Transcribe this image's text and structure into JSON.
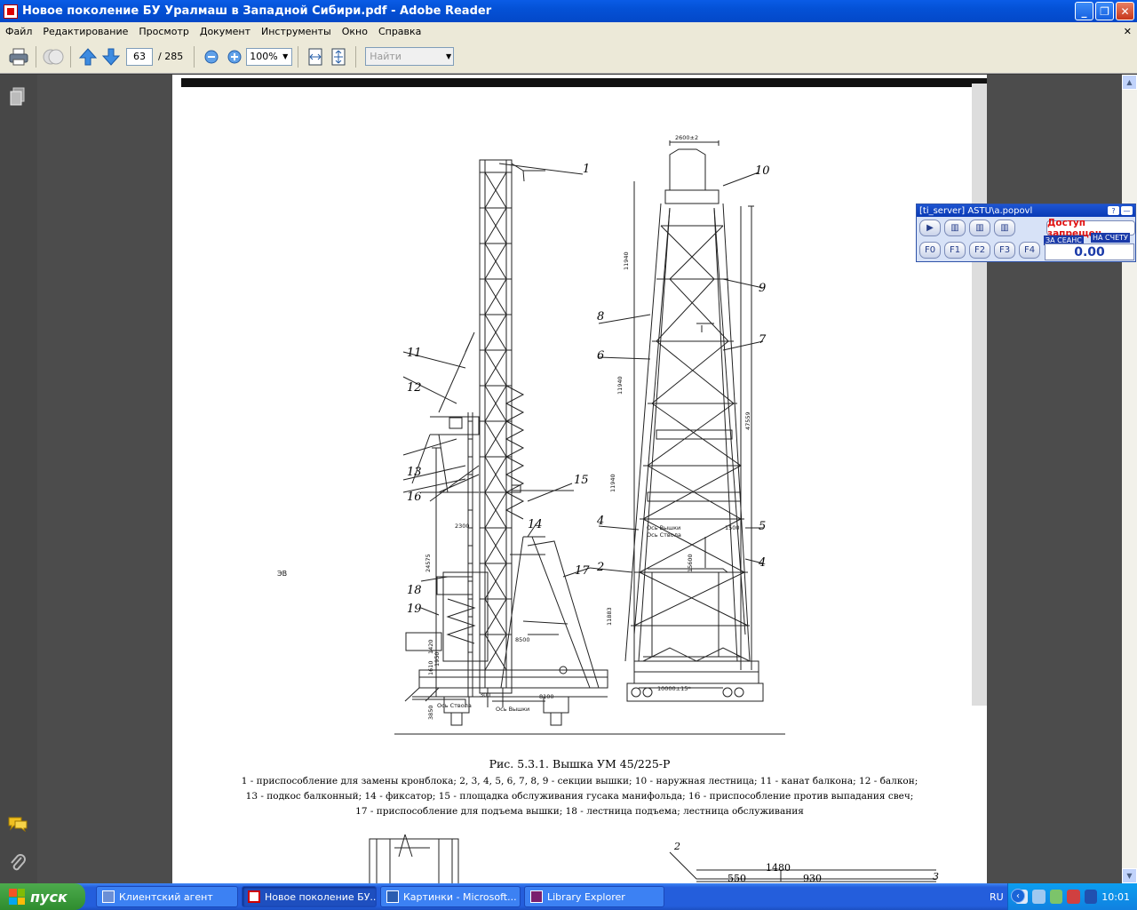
{
  "window": {
    "title": "Новое поколение БУ Уралмаш в Западной Сибири.pdf - Adobe Reader"
  },
  "menu": [
    "Файл",
    "Редактирование",
    "Просмотр",
    "Документ",
    "Инструменты",
    "Окно",
    "Справка"
  ],
  "toolbar": {
    "page_current": "63",
    "page_total": "/ 285",
    "zoom": "100%",
    "find_placeholder": "Найти"
  },
  "drawing": {
    "left_labels": [
      "1",
      "11",
      "12",
      "13",
      "16",
      "15",
      "14",
      "17",
      "18",
      "19"
    ],
    "right_labels": [
      "10",
      "9",
      "8",
      "7",
      "6",
      "4",
      "5",
      "2",
      "4"
    ],
    "dims": {
      "top": "2600±2",
      "base": "10000±15*",
      "d2300": "2300",
      "d24575": "24575",
      "d8500": "8500",
      "d8100": "8100",
      "d300": "300",
      "d3850": "3850",
      "axis1": "Ось Вышки",
      "axis2": "Ось Ствола",
      "d11940a": "11940",
      "d11940b": "11940",
      "d11940c": "11940",
      "d11883": "11883",
      "d47559": "47559",
      "d15600": "15600",
      "d1500": "1500",
      "d1420": "1420",
      "d1610": "1610",
      "d1950": "1950"
    },
    "side_mark": "ЭВ"
  },
  "caption": {
    "title": "Рис. 5.3.1. Вышка УМ 45/225-Р",
    "line1": "1 - приспособление для замены кронблока; 2, 3, 4, 5, 6, 7, 8, 9 - секции вышки; 10 - наружная лестница; 11 - канат балкона; 12 - балкон;",
    "line2": "13 - подкос балконный; 14 - фиксатор; 15 - площадка обслуживания гусака манифольда; 16 - приспособление против выпадания свеч;",
    "line3": "17 - приспособление для подъема вышки; 18 - лестница подъема; лестница обслуживания"
  },
  "next_fig": {
    "n2": "2",
    "n3": "3",
    "d1480": "1480",
    "d550": "550",
    "d930": "930"
  },
  "widget": {
    "title": "[ti_server] ASTU\\a.popovl",
    "status": "Доступ запрещен",
    "session_tag": "ЗА СЕАНС",
    "account_tag": "НА СЧЕТУ",
    "balance": "0.00",
    "fkeys": [
      "F0",
      "F1",
      "F2",
      "F3",
      "F4"
    ]
  },
  "taskbar": {
    "start": "пуск",
    "tasks": [
      {
        "label": "Клиентский агент",
        "active": false
      },
      {
        "label": "Новое поколение БУ...",
        "active": true
      },
      {
        "label": "Картинки - Microsoft...",
        "active": false
      },
      {
        "label": "Library Explorer",
        "active": false
      }
    ],
    "lang": "RU",
    "clock": "10:01"
  }
}
